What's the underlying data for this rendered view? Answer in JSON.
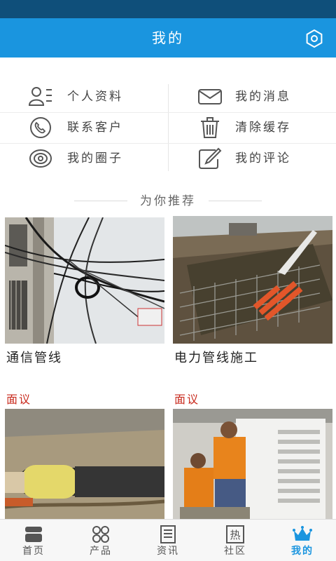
{
  "header": {
    "title": "我的"
  },
  "menu": {
    "profile": "个人资料",
    "messages": "我的消息",
    "contact_service": "联系客户",
    "clear_cache": "清除缓存",
    "my_circle": "我的圈子",
    "my_comments": "我的评论"
  },
  "recommend": {
    "heading": "为你推荐",
    "items": [
      {
        "name": "通信管线",
        "price": "面议"
      },
      {
        "name": "电力管线施工",
        "price": "面议"
      },
      {
        "name": "",
        "price": ""
      },
      {
        "name": "",
        "price": ""
      }
    ]
  },
  "tabs": [
    {
      "label": "首页",
      "icon": "home-icon"
    },
    {
      "label": "产品",
      "icon": "product-icon"
    },
    {
      "label": "资讯",
      "icon": "news-icon"
    },
    {
      "label": "社区",
      "icon": "community-icon"
    },
    {
      "label": "我的",
      "icon": "crown-icon"
    }
  ],
  "colors": {
    "primary": "#1a95df",
    "status_bar": "#0f4f7a",
    "price": "#c8291c"
  }
}
